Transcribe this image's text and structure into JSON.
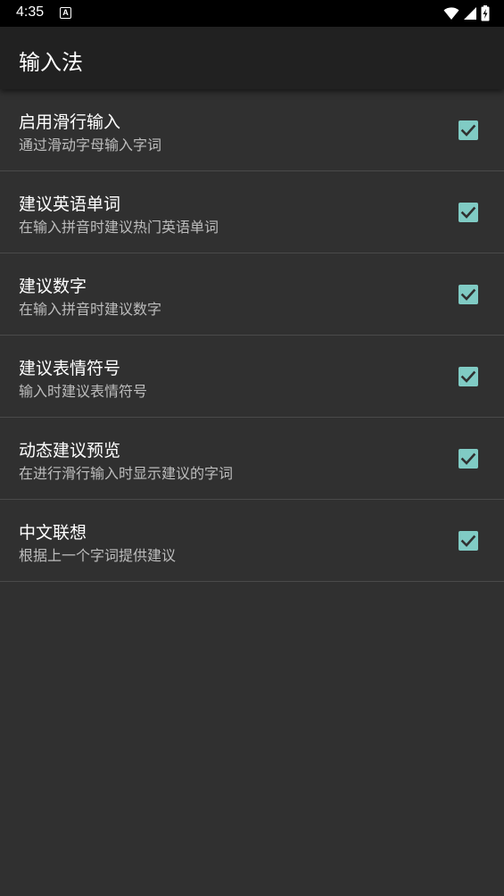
{
  "status_bar": {
    "time": "4:35",
    "notification_icon": "a-icon",
    "icons": [
      "wifi-icon",
      "signal-icon",
      "battery-charging-icon"
    ]
  },
  "app_bar": {
    "title": "输入法"
  },
  "colors": {
    "accent": "#80cbc4",
    "background": "#303030",
    "app_bar": "#212121",
    "status_bar": "#000000",
    "divider": "#4a4a4a",
    "title_text": "#ffffff",
    "summary_text": "#bdbdbd"
  },
  "preferences": [
    {
      "title": "启用滑行输入",
      "summary": "通过滑动字母输入字词",
      "checked": true
    },
    {
      "title": "建议英语单词",
      "summary": "在输入拼音时建议热门英语单词",
      "checked": true
    },
    {
      "title": "建议数字",
      "summary": "在输入拼音时建议数字",
      "checked": true
    },
    {
      "title": "建议表情符号",
      "summary": "输入时建议表情符号",
      "checked": true
    },
    {
      "title": "动态建议预览",
      "summary": "在进行滑行输入时显示建议的字词",
      "checked": true
    },
    {
      "title": "中文联想",
      "summary": "根据上一个字词提供建议",
      "checked": true
    }
  ]
}
